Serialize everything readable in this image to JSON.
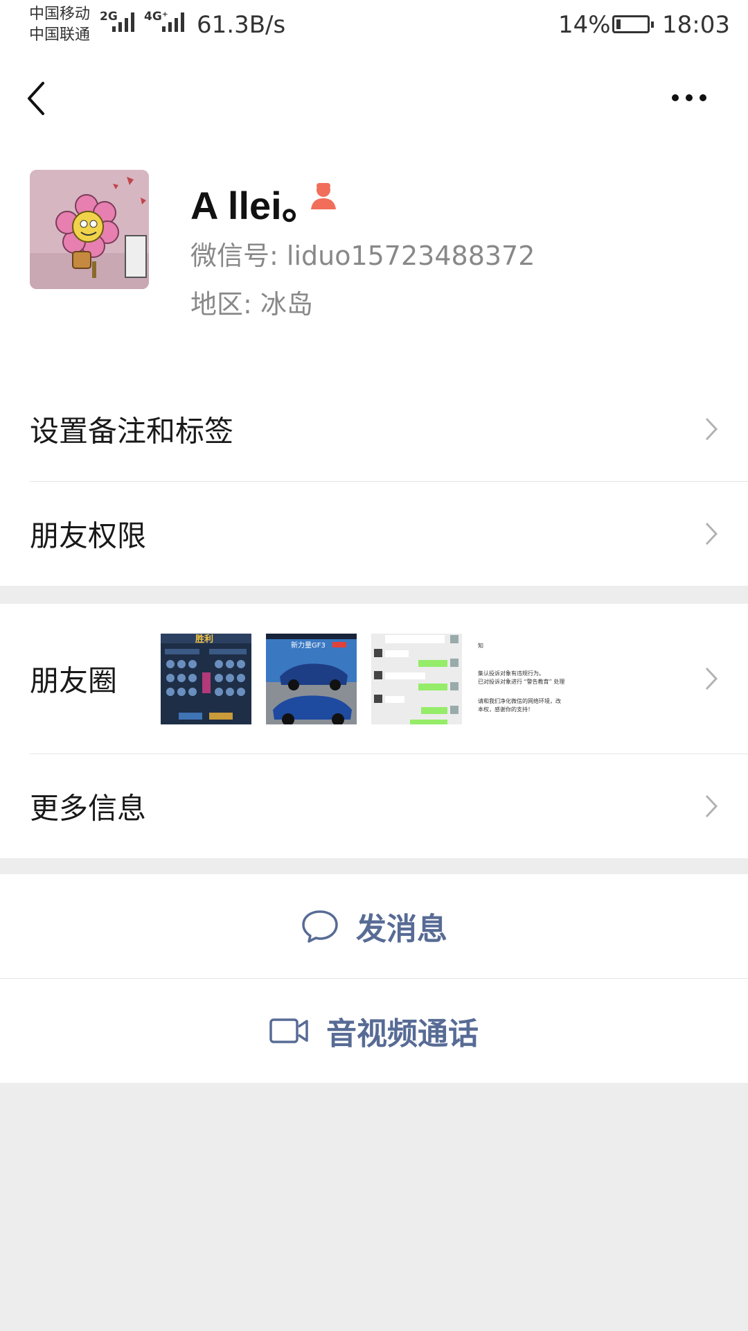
{
  "status_bar": {
    "carrier_1": "中国移动",
    "carrier_2": "中国联通",
    "sim1_network": "2G",
    "sim2_network": "4G⁺",
    "net_speed": "61.3B/s",
    "battery_percent": "14%",
    "battery_level": 0.14,
    "time": "18:03"
  },
  "profile": {
    "name": "A llei。",
    "wechat_id": "微信号: liduo15723488372",
    "region": "地区: 冰岛",
    "gender_icon": "female-icon",
    "gender_color": "#f06e5a"
  },
  "menu": {
    "remark_tags": "设置备注和标签",
    "friend_permissions": "朋友权限",
    "moments": "朋友圈",
    "more_info": "更多信息"
  },
  "moments_thumbs": {
    "t1_title": "胜利",
    "t2_title": "新力量GF3",
    "t4_lines": [
      "知",
      "集认投诉对象有违规行为。",
      "已对投诉对象进行 “警告教育” 处理",
      "请和我们净化微信的网络环境，改",
      "本权，感谢你的支持！"
    ]
  },
  "actions": {
    "send_message": "发消息",
    "video_call": "音视频通话"
  },
  "colors": {
    "link_blue": "#576b95",
    "background": "#ededed"
  }
}
